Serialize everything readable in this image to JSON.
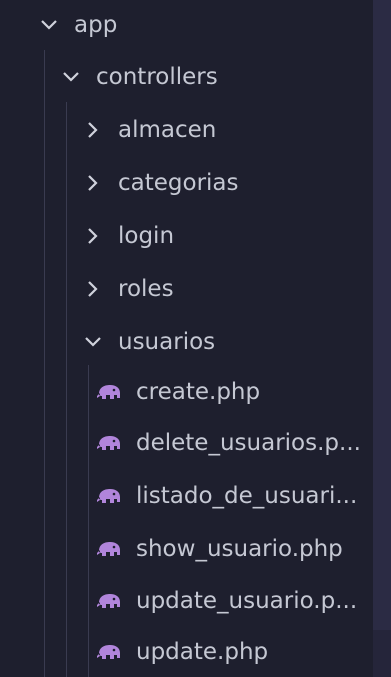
{
  "explorer": {
    "folders": {
      "app": "app",
      "controllers": "controllers",
      "almacen": "almacen",
      "categorias": "categorias",
      "login": "login",
      "roles": "roles",
      "usuarios": "usuarios"
    },
    "files": [
      {
        "label": "create.php",
        "icon": "php-elephant-icon"
      },
      {
        "label": "delete_usuarios.p...",
        "icon": "php-elephant-icon"
      },
      {
        "label": "listado_de_usuari...",
        "icon": "php-elephant-icon"
      },
      {
        "label": "show_usuario.php",
        "icon": "php-elephant-icon"
      },
      {
        "label": "update_usuario.p...",
        "icon": "php-elephant-icon"
      },
      {
        "label": "update.php",
        "icon": "php-elephant-icon"
      }
    ],
    "colors": {
      "background": "#1e1f2e",
      "text": "#c5c8d3",
      "php_icon": "#b185db"
    }
  }
}
